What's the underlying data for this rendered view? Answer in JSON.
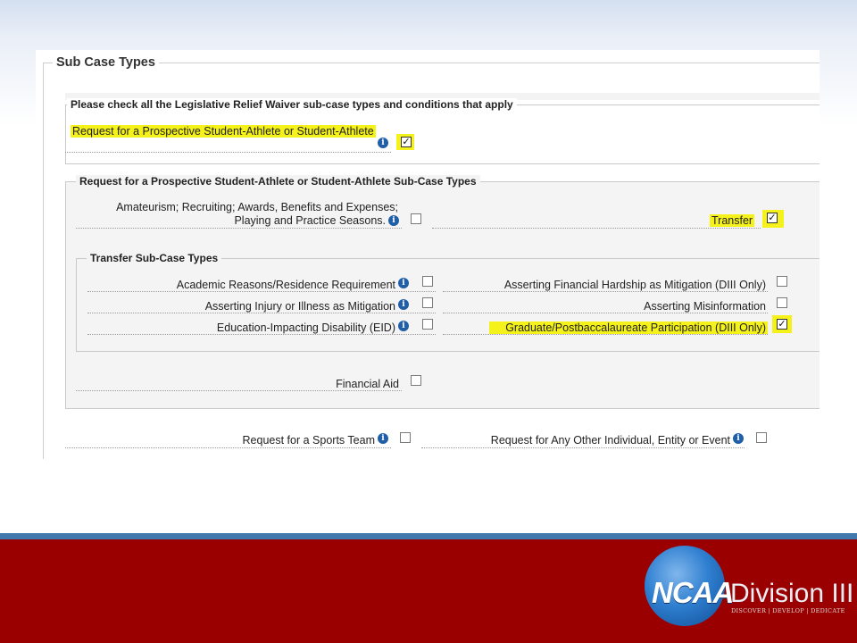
{
  "form": {
    "outer_legend": "Sub Case Types",
    "level1": {
      "legend": "Please check all the Legislative Relief Waiver sub-case types and conditions that apply",
      "prospective": {
        "label": "Request for a Prospective Student-Athlete or Student-Athlete",
        "checked": true,
        "mark": "✓"
      }
    },
    "level2": {
      "legend": "Request for a Prospective Student-Athlete or Student-Athlete Sub-Case Types",
      "amateurism": {
        "label_line1": "Amateurism; Recruiting; Awards, Benefits and Expenses;",
        "label_line2": "Playing and Practice Seasons.",
        "checked": false
      },
      "transfer": {
        "label": "Transfer",
        "checked": true,
        "mark": "✓"
      },
      "financial_aid": {
        "label": "Financial Aid",
        "checked": false
      }
    },
    "level3": {
      "legend": "Transfer Sub-Case Types",
      "academic": {
        "label": "Academic Reasons/Residence Requirement",
        "checked": false
      },
      "injury": {
        "label": "Asserting Injury or Illness as Mitigation",
        "checked": false
      },
      "eid": {
        "label": "Education-Impacting Disability (EID)",
        "checked": false
      },
      "hardship": {
        "label": "Asserting Financial Hardship as Mitigation (DIII Only)",
        "checked": false
      },
      "misinformation": {
        "label": "Asserting Misinformation",
        "checked": false
      },
      "graduate": {
        "label": "Graduate/Postbaccalaureate Participation (DIII Only)",
        "checked": true,
        "mark": "✓"
      }
    },
    "sports_team": {
      "label": "Request for a Sports Team",
      "checked": false
    },
    "other_entity": {
      "label": "Request for Any Other Individual, Entity or Event",
      "checked": false
    },
    "info_glyph": "i"
  },
  "footer": {
    "logo_text": "NCAA",
    "division_text": "Division III",
    "tagline": "DISCOVER | DEVELOP | DEDICATE"
  },
  "colors": {
    "highlight": "#f4f21a",
    "info_icon": "#1f5fa8",
    "footer_red": "#9b0000",
    "footer_stripe": "#3f79ad"
  },
  "icons": {
    "info": "info-icon",
    "checkbox": "checkbox-icon",
    "logo": "ncaa-logo"
  }
}
